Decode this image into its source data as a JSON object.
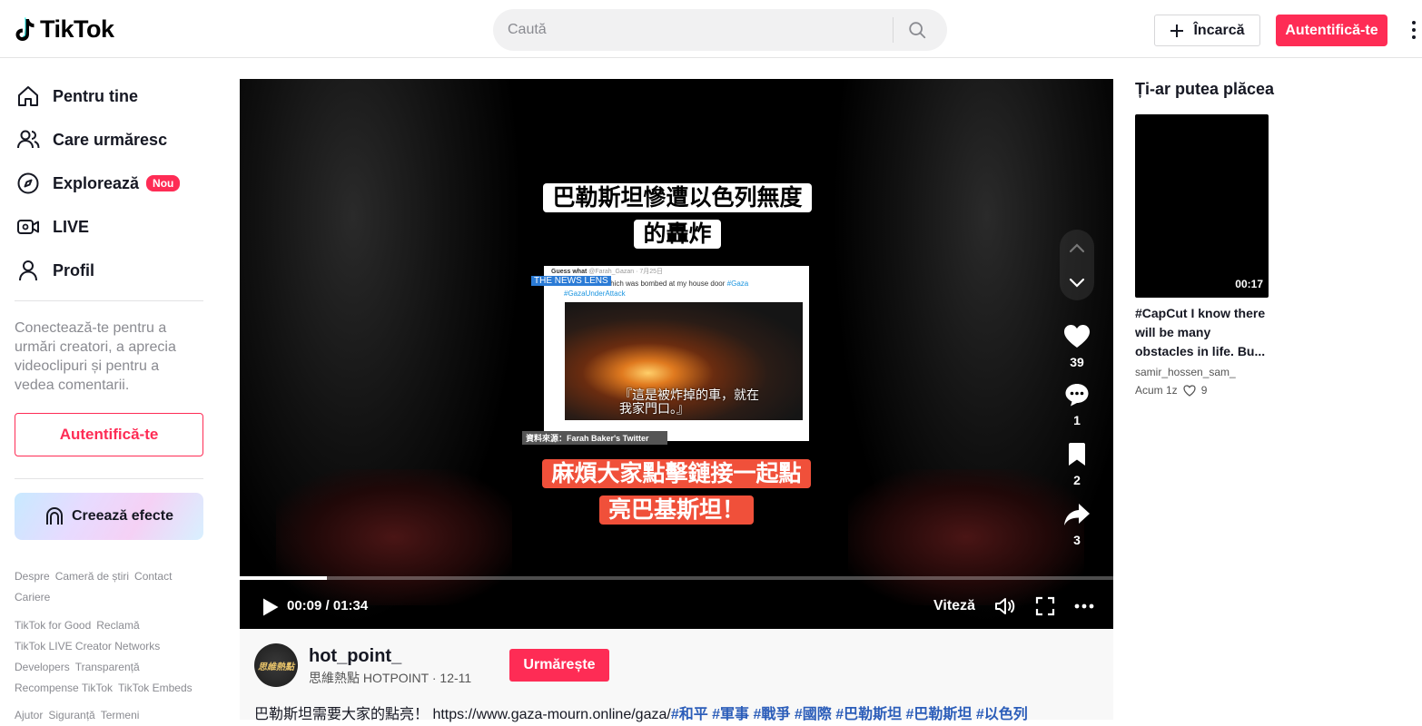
{
  "header": {
    "logo_text": "TikTok",
    "search_placeholder": "Caută",
    "upload_label": "Încarcă",
    "login_label": "Autentifică-te"
  },
  "sidebar": {
    "items": [
      {
        "label": "Pentru tine",
        "icon": "home-icon"
      },
      {
        "label": "Care urmăresc",
        "icon": "following-icon"
      },
      {
        "label": "Explorează",
        "icon": "compass-icon",
        "badge": "Nou"
      },
      {
        "label": "LIVE",
        "icon": "live-icon"
      },
      {
        "label": "Profil",
        "icon": "profile-icon"
      }
    ],
    "login_prompt": "Conectează-te pentru a urmări creatori, a aprecia videoclipuri și pentru a vedea comentarii.",
    "login_button": "Autentifică-te",
    "effects_button": "Creează efecte",
    "footer_links": [
      [
        "Despre",
        "Cameră de știri",
        "Contact"
      ],
      [
        "Cariere"
      ],
      [
        "TikTok for Good",
        "Reclamă"
      ],
      [
        "TikTok LIVE Creator Networks"
      ],
      [
        "Developers",
        "Transparență"
      ],
      [
        "Recompense TikTok",
        "TikTok Embeds"
      ],
      [
        "Ajutor",
        "Siguranță",
        "Termeni"
      ]
    ]
  },
  "video": {
    "caption_top": "巴勒斯坦慘遭以色列無度的轟炸",
    "caption_bottom": "麻煩大家點擊鏈接一起點亮巴基斯坦！",
    "tweet_author": "Guess what",
    "tweet_handle": "@Farah_Gazan · 7月25日",
    "tweet_text": "This is a car which was bombed at my house door",
    "tweet_tags": "#Gaza #GazaUnderAttack",
    "tweet_subtitle": "『這是被炸掉的車，就在我家門口。』",
    "watermark": "THE NEWS LENS",
    "credit": "資料來源：Farah Baker's Twitter",
    "likes": "39",
    "comments": "1",
    "saves": "2",
    "shares": "3",
    "time": "00:09 / 01:34",
    "progress_fraction": 0.1,
    "speed_label": "Viteză"
  },
  "author": {
    "avatar_text": "思維熱點",
    "username": "hot_point_",
    "nickname": "思維熱點 HOTPOINT · 12-11",
    "follow_label": "Urmărește",
    "description": "巴勒斯坦需要大家的點亮！ https://www.gaza-mourn.online/gaza/",
    "description_tags": "#和平 #軍事 #戰爭 #國際 #巴勒斯坦 #巴勒斯坦 #以色列"
  },
  "recommendations": {
    "title": "Ți-ar putea plăcea",
    "items": [
      {
        "duration": "00:17",
        "title": "#CapCut I know there will be many obstacles in life. Bu...",
        "author": "samir_hossen_sam_",
        "time": "Acum 1z",
        "likes": "9"
      }
    ]
  },
  "colors": {
    "brand": "#fe2c55",
    "tag_blue": "#2b5db9"
  }
}
